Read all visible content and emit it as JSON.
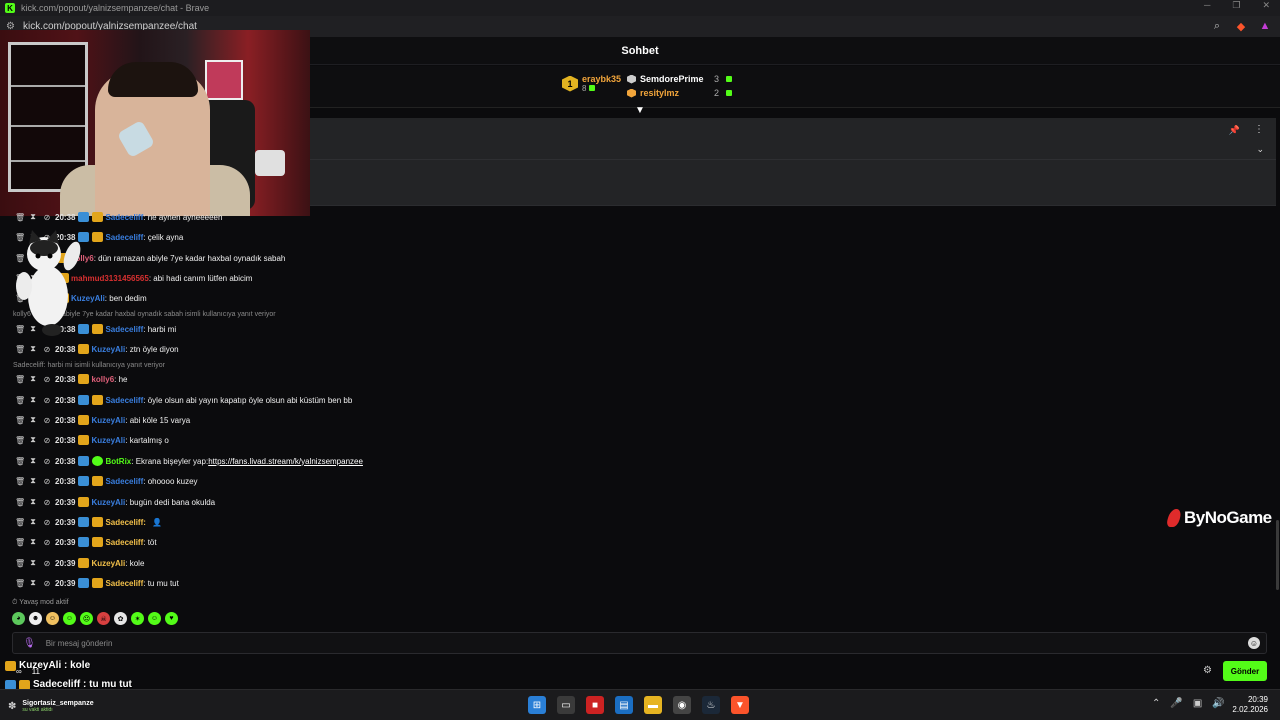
{
  "browser": {
    "title": "kick.com/popout/yalnizsempanzee/chat - Brave",
    "url": "kick.com/popout/yalnizsempanzee/chat"
  },
  "chat": {
    "header": "Sohbet",
    "leaderboard": {
      "first": {
        "rank": "1",
        "name": "eraybk35",
        "count": "8"
      },
      "second": {
        "name": "SemdorePrime",
        "count": "3"
      },
      "third": {
        "name": "resitylmz",
        "count": "2"
      }
    },
    "messages": [
      {
        "time": "20:38",
        "badge": "blue",
        "user": "Sadeceliff",
        "color": "#3a7fe0",
        "text": ": ne aynen ayneeeeen"
      },
      {
        "time": "20:38",
        "badge": "blue",
        "user": "Sadeceliff",
        "color": "#3a7fe0",
        "text": ": çelik ayna"
      },
      {
        "time": "",
        "badge": "none",
        "user": "kolly6",
        "color": "#e0607a",
        "text": ": dün ramazan abiyle 7ye kadar haxbal oynadık sabah"
      },
      {
        "time": "",
        "badge": "none",
        "user": "mahmud3131456565",
        "color": "#d83030",
        "text": ": abi hadi canım lütfen abicim"
      },
      {
        "time": "",
        "badge": "none",
        "user": "KuzeyAli",
        "color": "#3a7fe0",
        "text": ": ben dedim"
      },
      {
        "time": "20:38",
        "badge": "blue",
        "user": "Sadeceliff",
        "color": "#3a7fe0",
        "text": ": harbi mi"
      },
      {
        "time": "20:38",
        "badge": "none",
        "user": "KuzeyAli",
        "color": "#3a7fe0",
        "text": ": ztn öyle diyon"
      },
      {
        "time": "20:38",
        "badge": "none",
        "user": "kolly6",
        "color": "#e0607a",
        "text": ": he"
      },
      {
        "time": "20:38",
        "badge": "blue",
        "user": "Sadeceliff",
        "color": "#3a7fe0",
        "text": ": öyle olsun abi yayın kapatıp öyle olsun abi küstüm ben bb"
      },
      {
        "time": "20:38",
        "badge": "none",
        "user": "KuzeyAli",
        "color": "#3a7fe0",
        "text": ": abi köle 15 varya"
      },
      {
        "time": "20:38",
        "badge": "none",
        "user": "KuzeyAli",
        "color": "#3a7fe0",
        "text": ": kartalmış o"
      },
      {
        "time": "20:38",
        "badge": "bot",
        "user": "BotRix",
        "color": "#53fc18",
        "text": ": Ekrana bişeyler yap: ",
        "link": "https://fans.livad.stream/k/yalnizsempanzee"
      },
      {
        "time": "20:38",
        "badge": "blue",
        "user": "Sadeceliff",
        "color": "#3a7fe0",
        "text": ": ohoooo kuzey"
      },
      {
        "time": "20:39",
        "badge": "none",
        "user": "KuzeyAli",
        "color": "#3a7fe0",
        "text": ": bugün dedi bana okulda"
      },
      {
        "time": "20:39",
        "badge": "blue",
        "user": "Sadeceliff:",
        "color": "#f2c04a",
        "text": ""
      },
      {
        "time": "20:39",
        "badge": "blue",
        "user": "Sadeceliff",
        "color": "#f2c04a",
        "text": ": töt"
      },
      {
        "time": "20:39",
        "badge": "none",
        "user": "KuzeyAli",
        "color": "#f2c04a",
        "text": ": kole"
      },
      {
        "time": "20:39",
        "badge": "blue",
        "user": "Sadeceliff",
        "color": "#f2c04a",
        "text": ": tu mu tut"
      }
    ],
    "replies": [
      "kolly6 ramazan abiyle 7ye kadar haxbal oynadık sabah isimli kullanıcıya yanıt veriyor",
      "Sadeceliff: harbi mi isimli kullanıcıya yanıt veriyor"
    ],
    "slow_mode": "Yavaş mod aktif",
    "input_placeholder": "Bir mesaj gönderin",
    "send_label": "Gönder"
  },
  "overlay": {
    "line1": "KuzeyAli : kole",
    "line2": "Sadeceliff : tu mu tut",
    "stat1": "∞",
    "stat2": "11"
  },
  "sponsor": "ByNoGame",
  "taskbar": {
    "user": "Sigortasiz_sempanze",
    "status": "su vakti aktidı",
    "time": "20:39",
    "date": "2.02.2026"
  }
}
